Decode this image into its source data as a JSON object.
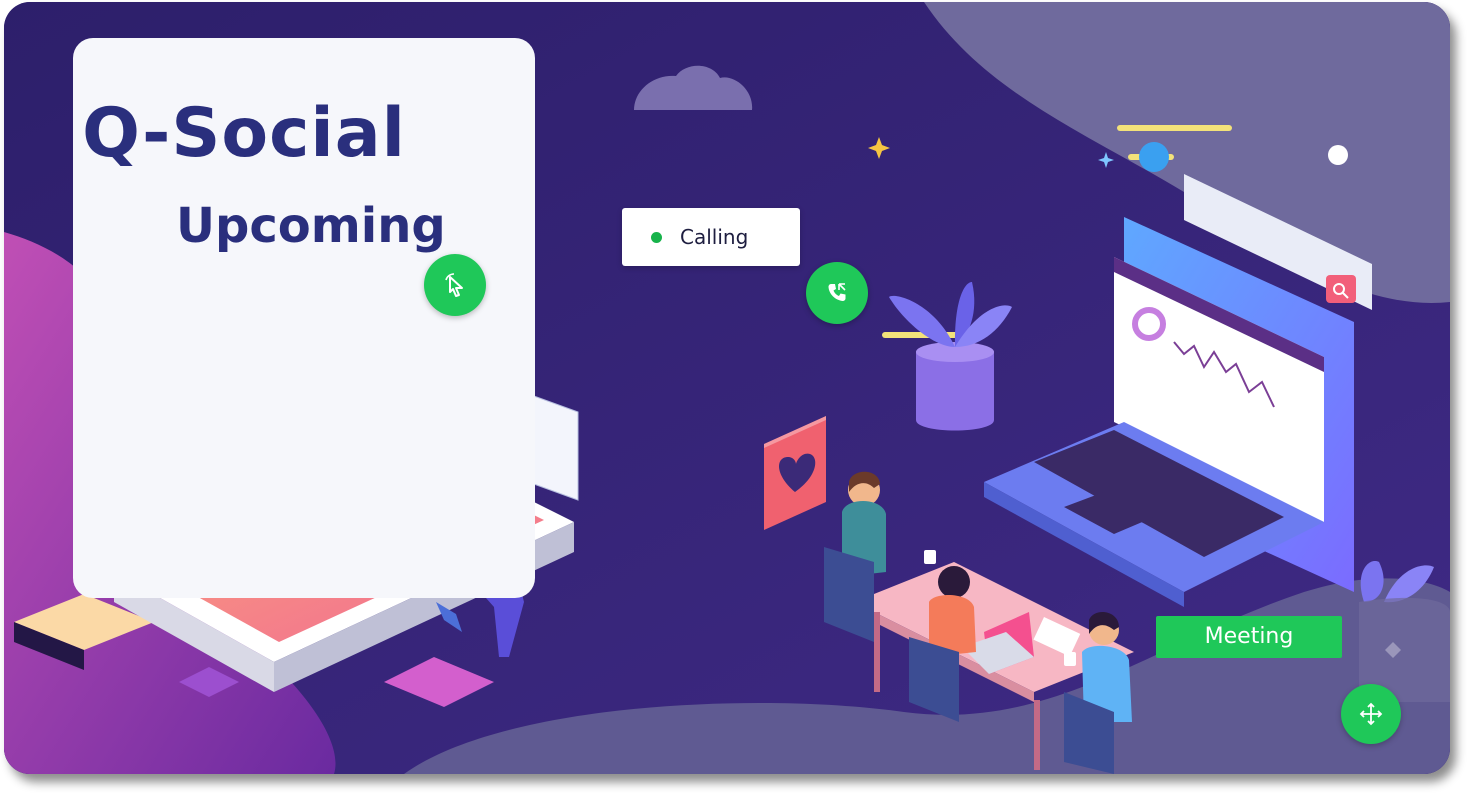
{
  "banner": {
    "title": "Q-Social",
    "subtitle": "Upcoming",
    "calling_label": "Calling",
    "meeting_label": "Meeting"
  },
  "icons": {
    "cursor_button": "cursor-icon",
    "call_button": "phone-icon",
    "move_button": "move-arrows-icon",
    "heart": "heart-icon",
    "search": "search-icon",
    "mail": "mail-icon"
  },
  "colors": {
    "background": "#3b2a78",
    "title": "#2a2f7d",
    "accent_green": "#1fc859",
    "panel": "#f6f7fb"
  }
}
